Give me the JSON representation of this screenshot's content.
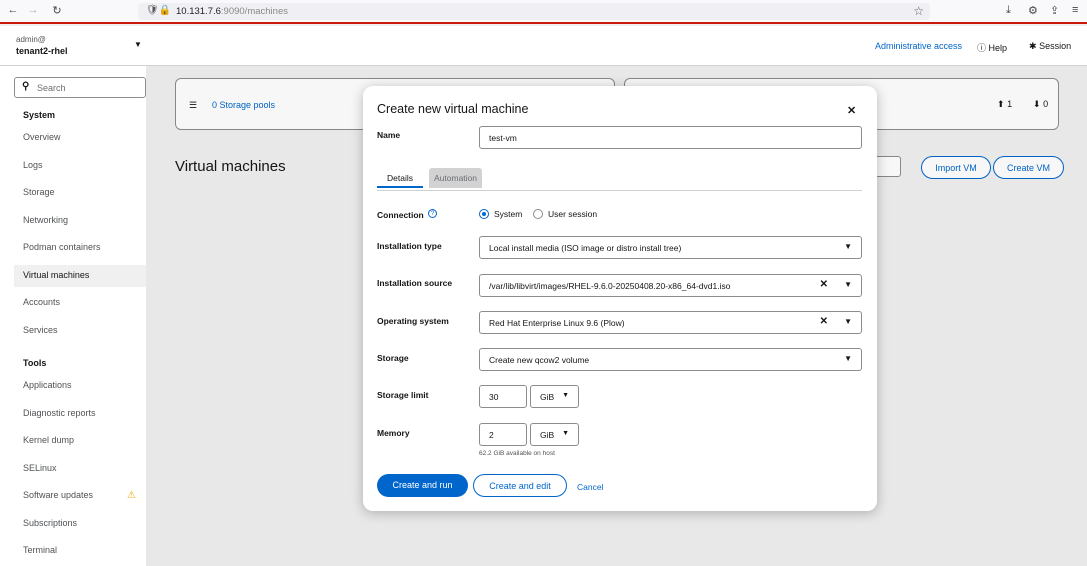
{
  "browser": {
    "url_host": "10.131.7.6",
    "url_rest": ":9090/machines",
    "icons": [
      "back-arrow-icon",
      "forward-arrow-icon",
      "reload-icon",
      "shield-icon",
      "lock-icon",
      "star-icon",
      "download-icon",
      "extension-icon",
      "share-icon",
      "menu-icon"
    ]
  },
  "masthead": {
    "user": "admin@",
    "host": "tenant2-rhel",
    "admin_access": "Administrative access",
    "help": "Help",
    "session": "Session"
  },
  "sidebar": {
    "search_placeholder": "Search",
    "system_heading": "System",
    "system_items": [
      "Overview",
      "Logs",
      "Storage",
      "Networking",
      "Podman containers",
      "Virtual machines",
      "Accounts",
      "Services"
    ],
    "tools_heading": "Tools",
    "tools_items": [
      "Applications",
      "Diagnostic reports",
      "Kernel dump",
      "SELinux",
      "Software updates",
      "Subscriptions",
      "Terminal"
    ],
    "active_item": "Virtual machines",
    "warning_item": "Software updates"
  },
  "main": {
    "storage_pools_link": "0 Storage pools",
    "stat_running": "1",
    "stat_shutoff": "0",
    "page_title": "Virtual machines",
    "import_vm": "Import VM",
    "create_vm": "Create VM"
  },
  "modal": {
    "title": "Create new virtual machine",
    "name_label": "Name",
    "name_value": "test-vm",
    "tabs": [
      "Details",
      "Automation"
    ],
    "connection_label": "Connection",
    "connection_options": [
      "System",
      "User session"
    ],
    "connection_selected": "System",
    "install_type_label": "Installation type",
    "install_type_value": "Local install media (ISO image or distro install tree)",
    "install_source_label": "Installation source",
    "install_source_value": "/var/lib/libvirt/images/RHEL-9.6.0-20250408.20-x86_64-dvd1.iso",
    "os_label": "Operating system",
    "os_value": "Red Hat Enterprise Linux 9.6 (Plow)",
    "storage_label": "Storage",
    "storage_value": "Create new qcow2 volume",
    "storage_limit_label": "Storage limit",
    "storage_limit_value": "30",
    "storage_limit_unit": "GiB",
    "memory_label": "Memory",
    "memory_value": "2",
    "memory_unit": "GiB",
    "memory_helper": "62.2 GiB available on host",
    "create_and_run": "Create and run",
    "create_and_edit": "Create and edit",
    "cancel": "Cancel"
  },
  "colors": {
    "accent": "#0066cc",
    "browser_underline": "#c9190b",
    "warning": "#f0ab00"
  }
}
